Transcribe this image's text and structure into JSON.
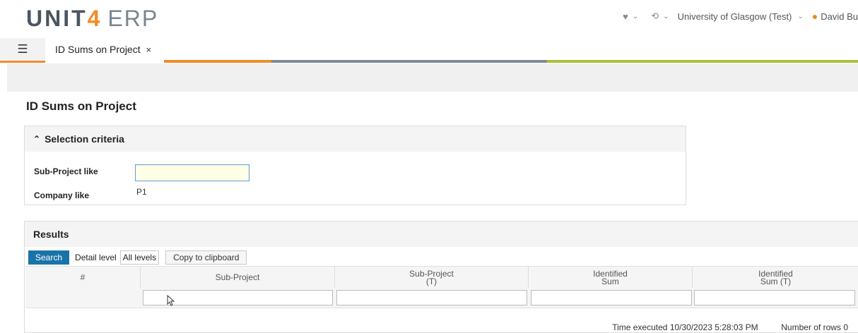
{
  "header": {
    "logo_text": "UNIT",
    "logo_number": "4",
    "logo_suffix": "ERP",
    "favorites_icon": "heart-icon",
    "history_icon": "history-icon",
    "environment": "University of Glasgow (Test)",
    "user_name": "David Bu",
    "accent_color": "#f28c28"
  },
  "tabs": [
    {
      "label": "ID Sums on Project",
      "close": "×"
    }
  ],
  "page": {
    "title": "ID Sums on Project"
  },
  "criteria": {
    "title": "Selection criteria",
    "fields": [
      {
        "label": "Sub-Project like",
        "value": "",
        "placeholder": ""
      },
      {
        "label": "Company like",
        "value": "P1"
      }
    ]
  },
  "results": {
    "title": "Results",
    "toolbar": {
      "search_label": "Search",
      "detail_level_label": "Detail level",
      "detail_level_value": "All levels",
      "copy_label": "Copy to clipboard"
    },
    "columns": [
      "#",
      "Sub-Project",
      "Sub-Project\n(T)",
      "Identified\nSum",
      "Identified\nSum (T)"
    ],
    "rows": [],
    "footer": {
      "time_label": "Time executed",
      "time_value": "10/30/2023 5:28:03 PM",
      "rows_label": "Number of rows",
      "rows_value": "0"
    }
  }
}
